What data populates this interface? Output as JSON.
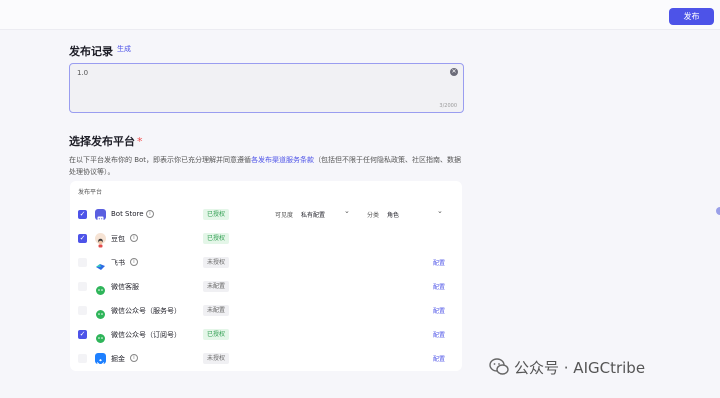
{
  "header": {
    "publish_label": "发布"
  },
  "record": {
    "title": "发布记录",
    "generate_label": "生成",
    "value": "1.0",
    "counter": "3/2000"
  },
  "platform": {
    "title": "选择发布平台",
    "required_mark": "*",
    "desc_before": "在以下平台发布你的 Bot，即表示你已充分理解并同意遵循",
    "desc_link": "各发布渠道服务条款",
    "desc_after": "（包括但不限于任何隐私政策、社区指南、数据处理协议等）。",
    "panel_header": "发布平台",
    "visibility_label": "可见度",
    "visibility_value": "私有配置",
    "category_label": "分类",
    "category_value": "角色",
    "rows": [
      {
        "name": "Bot Store",
        "checked": true,
        "status": "已授权",
        "icon": "bot-store-icon",
        "config": ""
      },
      {
        "name": "豆包",
        "checked": true,
        "status": "已授权",
        "icon": "doubao-icon",
        "config": ""
      },
      {
        "name": "飞书",
        "checked": false,
        "status": "未授权",
        "icon": "feishu-icon",
        "config": "配置"
      },
      {
        "name": "微信客服",
        "checked": false,
        "status": "未配置",
        "icon": "wechat-icon",
        "config": "配置"
      },
      {
        "name": "微信公众号（服务号）",
        "checked": false,
        "status": "未配置",
        "icon": "wechat-icon",
        "config": "配置"
      },
      {
        "name": "微信公众号（订阅号）",
        "checked": true,
        "status": "已授权",
        "icon": "wechat-icon",
        "config": "配置"
      },
      {
        "name": "掘金",
        "checked": false,
        "status": "未授权",
        "icon": "juejin-icon",
        "config": "配置"
      }
    ]
  },
  "watermark": {
    "text": "公众号 · AIGCtribe"
  },
  "colors": {
    "accent": "#4d53e8",
    "authorized": "#2e9d4f",
    "wechat": "#2fb55a"
  }
}
